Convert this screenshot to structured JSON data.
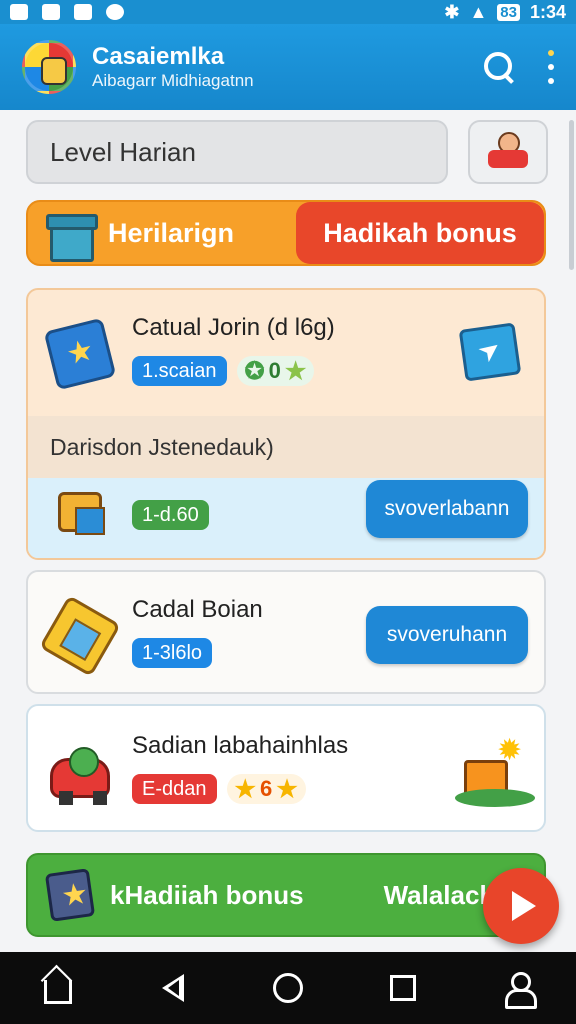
{
  "status_bar": {
    "time": "1:34",
    "battery": "83"
  },
  "app_bar": {
    "title": "Casaiemlka",
    "subtitle": "Aibagarr Midhiagatnn"
  },
  "level": {
    "label": "Level Harian"
  },
  "tabs": [
    {
      "label": "Herilarign"
    },
    {
      "label": "Hadikah bonus"
    }
  ],
  "items": [
    {
      "title": "Catual Jorin (d l6g)",
      "tag": "1.scaian",
      "stars": "0",
      "icon": "tablet-star-icon",
      "side_icon": "paper-plane-icon"
    },
    {
      "subheading": "Darisdon Jstenedauk)",
      "tag": "1-d.60",
      "button": "svoverlabann",
      "icon": "toolkit-icon"
    },
    {
      "title": "Cadal Boian",
      "tag": "1-3l6lo",
      "button": "svoveruhann",
      "icon": "phone-icon"
    },
    {
      "title": "Sadian labahainhlas",
      "tag": "E-ddan",
      "stars": "6",
      "icon": "toy-car-icon",
      "side_icon": "gift-box-icon"
    }
  ],
  "bonus_bar": {
    "label": "kHadiiah bonus",
    "right_label": "Walalach"
  },
  "colors": {
    "app_bar": "#1687cc",
    "tab_orange": "#f7a029",
    "tab_red": "#e8472a",
    "action_blue": "#1f88d6",
    "bonus_green": "#4caf3f"
  }
}
